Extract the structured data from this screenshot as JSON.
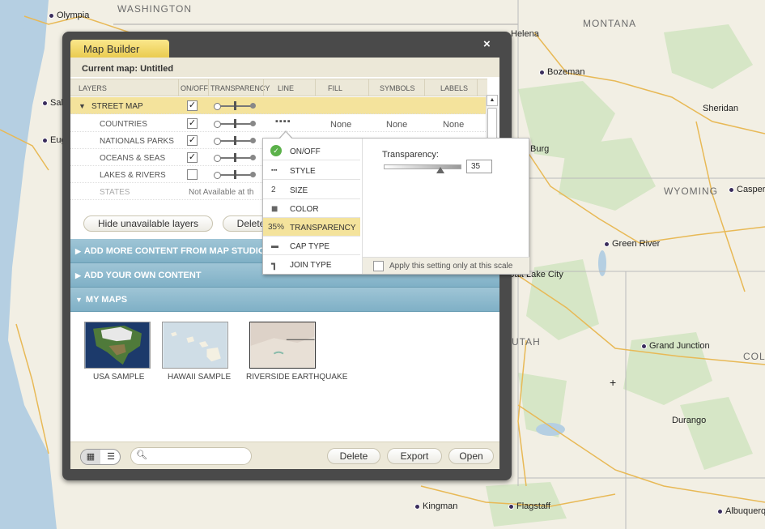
{
  "map": {
    "states": [
      "WASHINGTON",
      "MONTANA",
      "WYOMING",
      "UTAH",
      "COLO"
    ],
    "cities": [
      "Olympia",
      "Helena",
      "Bozeman",
      "Sheridan",
      "Casper",
      "Green River",
      "Salt Lake City",
      "Grand Junction",
      "Durango",
      "Kingman",
      "Flagstaff",
      "Albuquerque",
      "Sal",
      "Eug",
      "Burg"
    ]
  },
  "window": {
    "title": "Map Builder",
    "close": "×",
    "current_map": "Current map: Untitled"
  },
  "columns": [
    "LAYERS",
    "ON/OFF",
    "TRANSPARENCY",
    "LINE",
    "FILL",
    "SYMBOLS",
    "LABELS"
  ],
  "layers": [
    {
      "name": "STREET MAP",
      "on": true,
      "expanded": true
    },
    {
      "name": "COUNTRIES",
      "on": true,
      "line": "dashed",
      "fill": "None",
      "symbols": "None",
      "labels": "None"
    },
    {
      "name": "NATIONALS PARKS",
      "on": true
    },
    {
      "name": "OCEANS & SEAS",
      "on": true
    },
    {
      "name": "LAKES & RIVERS",
      "on": false
    },
    {
      "name": "STATES",
      "status": "Not Available at th"
    }
  ],
  "buttons": {
    "hide_unavailable": "Hide unavailable layers",
    "delete_layer": "Delete",
    "delete": "Delete",
    "export": "Export",
    "open": "Open"
  },
  "sections": [
    {
      "label": "ADD MORE CONTENT FROM MAP STUDIO"
    },
    {
      "label": "ADD YOUR OWN CONTENT"
    },
    {
      "label": "MY MAPS"
    }
  ],
  "my_maps": [
    {
      "label": "USA SAMPLE"
    },
    {
      "label": "HAWAII SAMPLE"
    },
    {
      "label": "RIVERSIDE EARTHQUAKE"
    }
  ],
  "search": {
    "placeholder": ""
  },
  "style_menu": [
    {
      "icon": "✓",
      "label": "ON/OFF"
    },
    {
      "icon": "▪▪▪",
      "label": "STYLE"
    },
    {
      "icon": "2",
      "label": "SIZE"
    },
    {
      "icon": "■",
      "label": "COLOR"
    },
    {
      "icon": "35%",
      "label": "TRANSPARENCY",
      "selected": true
    },
    {
      "icon": "▬",
      "label": "CAP TYPE"
    },
    {
      "icon": "┓",
      "label": "JOIN TYPE"
    }
  ],
  "transparency": {
    "label": "Transparency:",
    "value": "35",
    "scale_option": "Apply this setting only at this scale"
  },
  "colors": {
    "accent_yellow": "#f4e39c",
    "section_blue": "#8ab8cc",
    "frame": "#4a4a4a"
  }
}
